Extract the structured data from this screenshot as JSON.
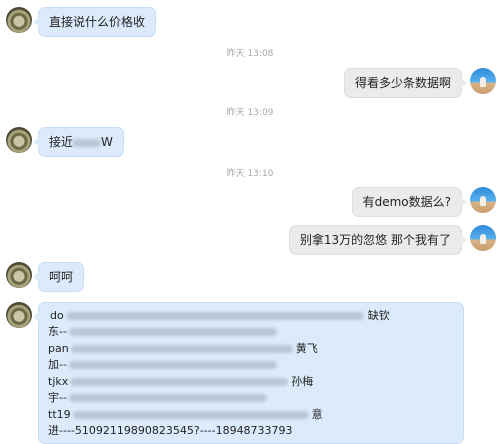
{
  "messages": [
    {
      "text": "直接说什么价格收"
    },
    {
      "text": "得看多少条数据啊"
    },
    {
      "prefix": "接近",
      "suffix": "W"
    },
    {
      "text": "有demo数据么?"
    },
    {
      "text": "别拿13万的忽悠  那个我有了"
    },
    {
      "text": "呵呵"
    }
  ],
  "timestamps": [
    "昨天 13:08",
    "昨天 13:09",
    "昨天 13:10"
  ],
  "data_lines": [
    {
      "prefix": "do",
      "suffix": "缺钦"
    },
    {
      "prefix": "东--",
      "suffix": ""
    },
    {
      "prefix": "pan",
      "suffix": "黄飞"
    },
    {
      "prefix": "加--",
      "suffix": ""
    },
    {
      "prefix": "tjkx",
      "suffix": "孙梅"
    },
    {
      "prefix": "宇--",
      "suffix": ""
    },
    {
      "prefix": "tt19",
      "suffix": "意"
    },
    {
      "prefix": "进----51092119890823545?----18948733793",
      "suffix": ""
    }
  ]
}
